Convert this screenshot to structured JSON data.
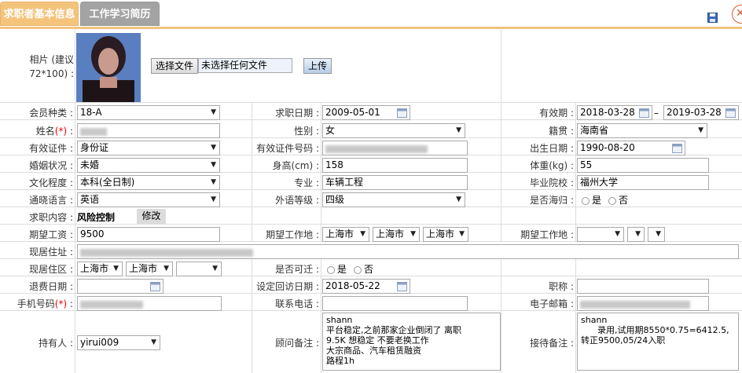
{
  "tabs": {
    "basic_info": "求职者基本信息",
    "work_history": "工作学习简历"
  },
  "photo": {
    "label": "相片 (建议72*100) :",
    "choose_file": "选择文件",
    "no_file": "未选择任何文件",
    "upload": "上传"
  },
  "member_type": {
    "label": "会员种类 :",
    "value": "18-A"
  },
  "job_date": {
    "label": "求职日期 :",
    "value": "2009-05-01"
  },
  "valid_period": {
    "label": "有效期 :",
    "from": "2018-03-28",
    "sep": "–",
    "to": "2019-03-28"
  },
  "name": {
    "label": "姓名",
    "req": "(*)",
    "colon": " :"
  },
  "gender": {
    "label": "性别 :",
    "value": "女"
  },
  "native_place": {
    "label": "籍贯 :",
    "value": "海南省"
  },
  "id_type": {
    "label": "有效证件 :",
    "value": "身份证"
  },
  "id_number": {
    "label": "有效证件号码 :"
  },
  "birth_date": {
    "label": "出生日期 :",
    "value": "1990-08-20"
  },
  "marital": {
    "label": "婚姻状况 :",
    "value": "未婚"
  },
  "height": {
    "label": "身高(cm) :",
    "value": "158"
  },
  "weight": {
    "label": "体重(kg) :",
    "value": "55"
  },
  "education": {
    "label": "文化程度 :",
    "value": "本科(全日制)"
  },
  "major": {
    "label": "专业 :",
    "value": "车辆工程"
  },
  "school": {
    "label": "毕业院校 :",
    "value": "福州大学"
  },
  "language": {
    "label": "通晓语言 :",
    "value": "英语"
  },
  "foreign_level": {
    "label": "外语等级 :",
    "value": "四级"
  },
  "overseas": {
    "label": "是否海归 :",
    "yes": "是",
    "no": "否"
  },
  "job_content": {
    "label": "求职内容 :",
    "value": "风险控制",
    "edit": "修改"
  },
  "salary": {
    "label": "期望工资 :",
    "value": "9500"
  },
  "expected_location": {
    "label": "期望工作地 :",
    "province": "上海市",
    "city": "上海市",
    "district": "上海市"
  },
  "expected_location2": {
    "label": "期望工作地 :"
  },
  "address": {
    "label": "现居住址 :"
  },
  "current_area": {
    "label": "现居住区 :",
    "province": "上海市",
    "city": "上海市"
  },
  "relocate": {
    "label": "是否可迁 :",
    "yes": "是",
    "no": "否"
  },
  "withdraw_date": {
    "label": "退费日期 :"
  },
  "revisit_date": {
    "label": "设定回访日期 :",
    "value": "2018-05-22"
  },
  "title": {
    "label": "职称 :"
  },
  "mobile": {
    "label": "手机号码",
    "req": "(*)",
    "colon": " :"
  },
  "phone": {
    "label": "联系电话 :"
  },
  "email": {
    "label": "电子邮箱 :"
  },
  "owner": {
    "label": "持有人 :",
    "value": "yirui009"
  },
  "consultant_note": {
    "label": "顾问备注 :",
    "value": "shann\n平台稳定,之前那家企业倒闭了 离职\n9.5K 想稳定 不要老换工作\n大宗商品、汽车租赁融资\n路程1h"
  },
  "reception_note": {
    "label": "接待备注 :",
    "value": "shann\n      录用,试用期8550*0.75=6412.5,\n转正9500,05/24入职"
  },
  "colors": {
    "tab_active": "#f4c47d",
    "tab_inactive": "#a3a3a3",
    "required": "#e00000",
    "border": "#dddddd"
  }
}
